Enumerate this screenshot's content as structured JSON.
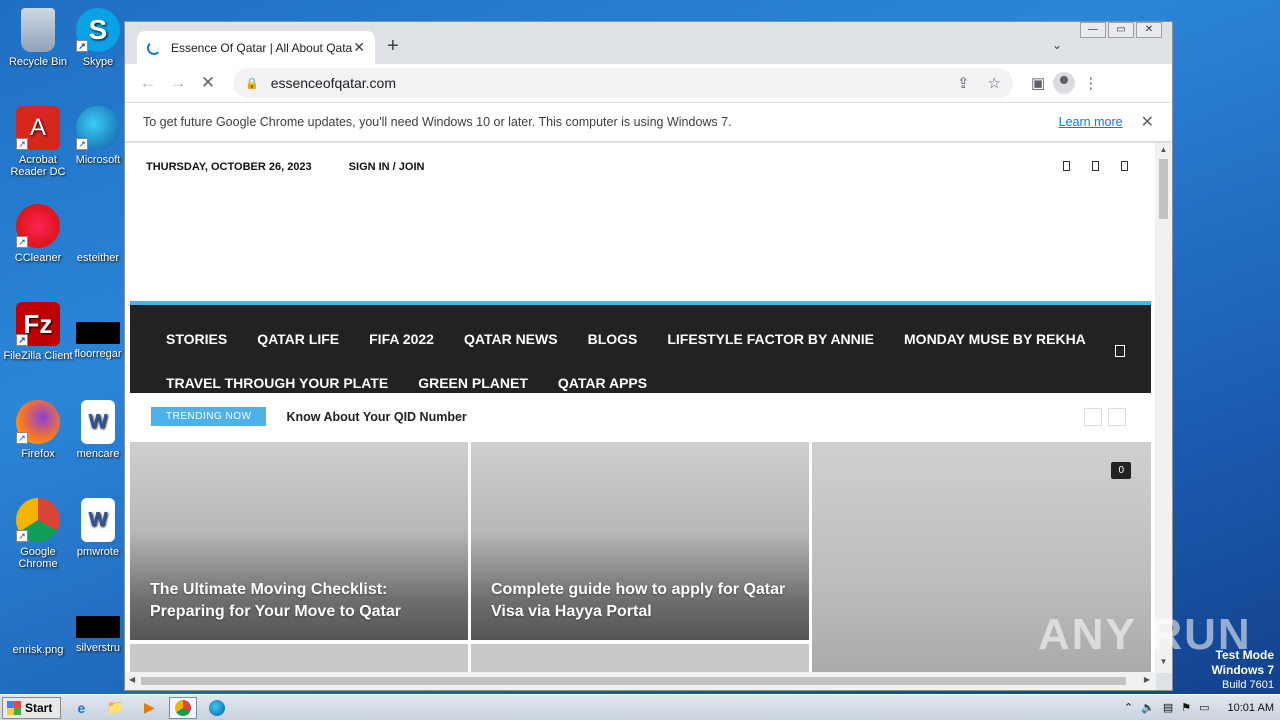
{
  "desktop": {
    "icons": [
      {
        "label": "Recycle Bin"
      },
      {
        "label": "Skype"
      },
      {
        "label": "Acrobat Reader DC"
      },
      {
        "label": "Microsoft"
      },
      {
        "label": "CCleaner"
      },
      {
        "label": "esteither"
      },
      {
        "label": "FileZilla Client"
      },
      {
        "label": "floorregar"
      },
      {
        "label": "Firefox"
      },
      {
        "label": "mencare"
      },
      {
        "label": "Google Chrome"
      },
      {
        "label": "pmwrote"
      },
      {
        "label": "enrisk.png"
      },
      {
        "label": "silverstru"
      }
    ],
    "watermark": "ANY RUN",
    "test_mode": {
      "line1": "Test Mode",
      "line2": "Windows 7",
      "line3": "Build 7601"
    }
  },
  "browser": {
    "tab": {
      "title": "Essence Of Qatar | All About Qatar",
      "close": "✕"
    },
    "new_tab": "+",
    "tab_dropdown": "⌄",
    "window_controls": {
      "minimize": "—",
      "maximize": "▭",
      "close": "✕"
    },
    "nav": {
      "back": "←",
      "forward": "→",
      "stop": "✕"
    },
    "address": {
      "url": "essenceofqatar.com",
      "lock": "🔒"
    },
    "infobar": {
      "message": "To get future Google Chrome updates, you'll need Windows 10 or later. This computer is using Windows 7.",
      "link": "Learn more",
      "close": "✕"
    }
  },
  "page": {
    "date": "THURSDAY, OCTOBER 26, 2023",
    "signin": "SIGN IN / JOIN",
    "menu_row1": [
      "STORIES",
      "QATAR LIFE",
      "FIFA 2022",
      "QATAR NEWS",
      "BLOGS",
      "LIFESTYLE FACTOR BY ANNIE",
      "MONDAY MUSE BY REKHA"
    ],
    "menu_row2": [
      "TRAVEL THROUGH YOUR PLATE",
      "GREEN PLANET",
      "QATAR APPS"
    ],
    "trending": {
      "badge": "TRENDING NOW",
      "headline": "Know About Your QID Number"
    },
    "cards": [
      {
        "title": "The Ultimate Moving Checklist: Preparing for Your Move to Qatar"
      },
      {
        "title": "Complete guide how to apply for Qatar Visa via Hayya Portal"
      },
      {
        "title": "",
        "comments": "0"
      }
    ]
  },
  "taskbar": {
    "start": "Start",
    "clock": "10:01 AM"
  }
}
